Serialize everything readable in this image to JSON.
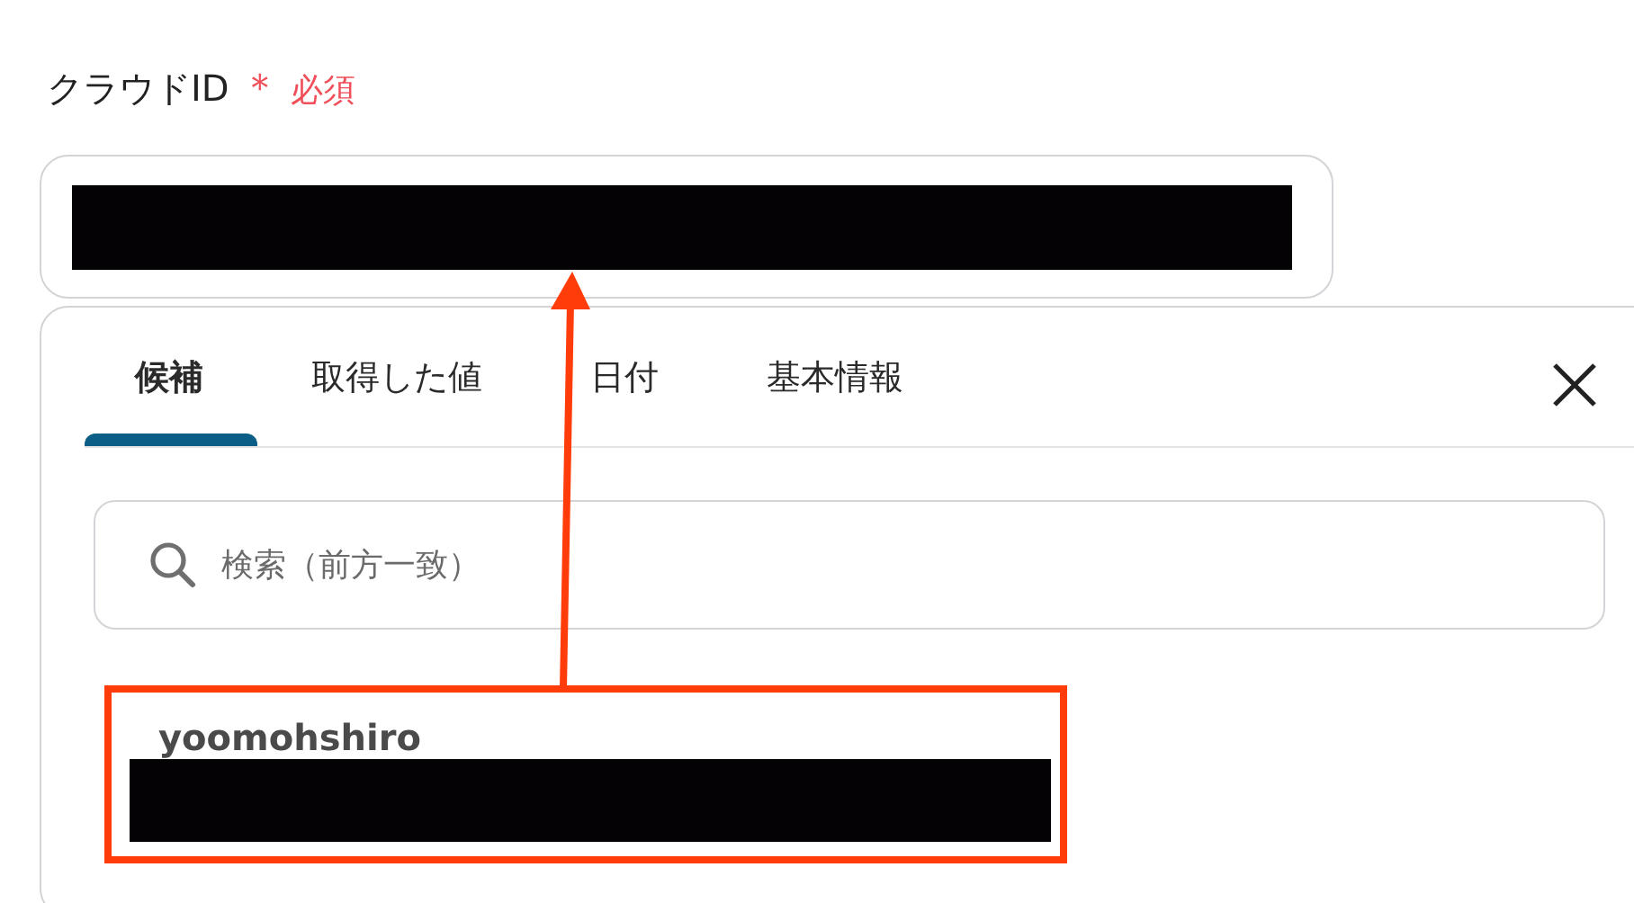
{
  "field": {
    "label": "クラウドID",
    "required_mark": "＊",
    "required_text": "必須"
  },
  "tabs": [
    {
      "label": "候補",
      "selected": true
    },
    {
      "label": "取得した値",
      "selected": false
    },
    {
      "label": "日付",
      "selected": false
    },
    {
      "label": "基本情報",
      "selected": false
    }
  ],
  "search": {
    "placeholder": "検索（前方一致）"
  },
  "candidates": [
    {
      "name": "yoomohshiro"
    }
  ]
}
